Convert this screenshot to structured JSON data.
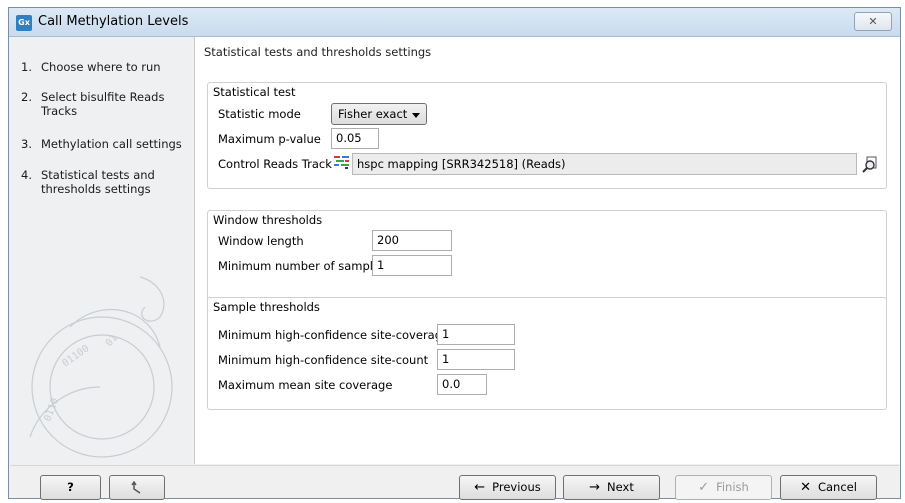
{
  "window": {
    "app_icon": "Gx",
    "title": "Call Methylation Levels",
    "close_glyph": "✕"
  },
  "sidebar": {
    "steps": [
      {
        "num": "1.",
        "label": "Choose where to run"
      },
      {
        "num": "2.",
        "label": "Select bisulfite Reads Tracks"
      },
      {
        "num": "3.",
        "label": "Methylation call settings"
      },
      {
        "num": "4.",
        "label": "Statistical tests and thresholds settings"
      }
    ]
  },
  "content": {
    "title": "Statistical tests and thresholds settings",
    "statistical_test": {
      "title": "Statistical test",
      "statistic_mode_label": "Statistic mode",
      "statistic_mode_value": "Fisher exact",
      "max_pvalue_label": "Maximum p-value",
      "max_pvalue_value": "0.05",
      "control_reads_label": "Control Reads Track",
      "control_reads_value": "hspc mapping [SRR342518] (Reads)"
    },
    "window_thresholds": {
      "title": "Window thresholds",
      "window_length_label": "Window length",
      "window_length_value": "200",
      "min_samples_label": "Minimum number of samples",
      "min_samples_value": "1"
    },
    "sample_thresholds": {
      "title": "Sample thresholds",
      "min_coverage_label": "Minimum high-confidence site-coverage",
      "min_coverage_value": "1",
      "min_count_label": "Minimum high-confidence site-count",
      "min_count_value": "1",
      "max_mean_label": "Maximum mean site coverage",
      "max_mean_value": "0.0"
    }
  },
  "buttons": {
    "help": "?",
    "previous": "Previous",
    "next": "Next",
    "finish": "Finish",
    "cancel": "Cancel"
  }
}
